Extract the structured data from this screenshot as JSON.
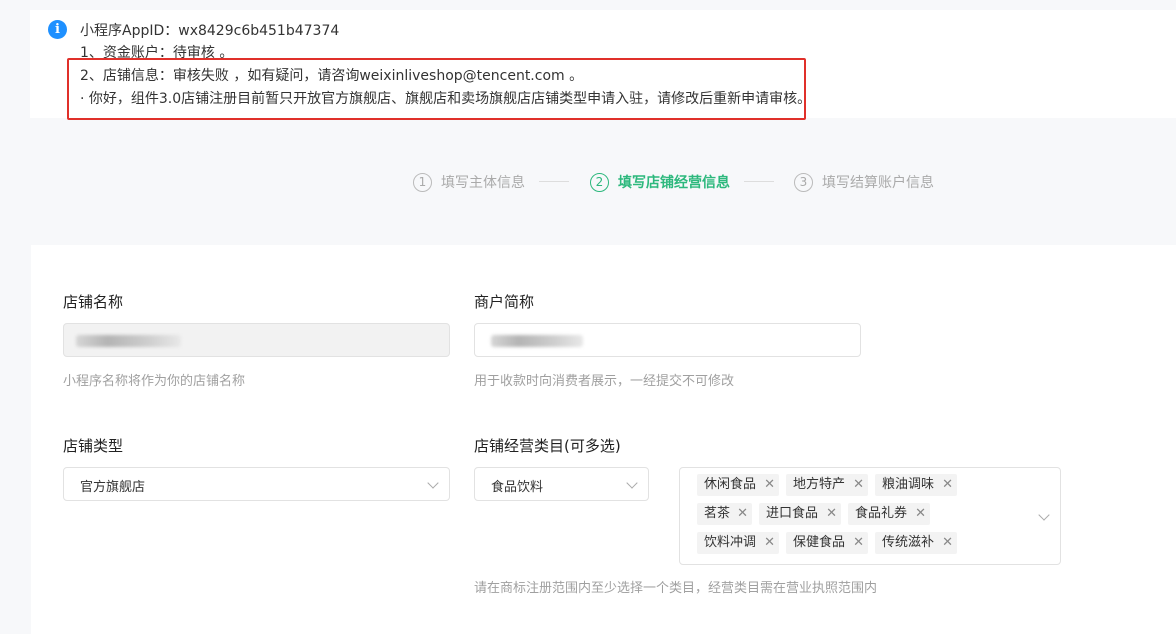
{
  "notice": {
    "appid_line": "小程序AppID：wx8429c6b451b47374",
    "line1": "1、资金账户：待审核 。",
    "line2": "2、店铺信息：审核失败 ，如有疑问，请咨询weixinliveshop@tencent.com 。",
    "line3": "· 你好，组件3.0店铺注册目前暂只开放官方旗舰店、旗舰店和卖场旗舰店店铺类型申请入驻，请修改后重新申请审核。"
  },
  "steps": [
    {
      "num": "1",
      "label": "填写主体信息"
    },
    {
      "num": "2",
      "label": "填写店铺经营信息"
    },
    {
      "num": "3",
      "label": "填写结算账户信息"
    }
  ],
  "form": {
    "shop_name_label": "店铺名称",
    "shop_name_hint": "小程序名称将作为你的店铺名称",
    "merchant_short_label": "商户简称",
    "merchant_short_hint": "用于收款时向消费者展示，一经提交不可修改",
    "shop_type_label": "店铺类型",
    "shop_type_value": "官方旗舰店",
    "category_label": "店铺经营类目(可多选)",
    "category_value": "食品饮料",
    "category_tags": [
      "休闲食品",
      "地方特产",
      "粮油调味",
      "茗茶",
      "进口食品",
      "食品礼券",
      "饮料冲调",
      "保健食品",
      "传统滋补"
    ],
    "category_hint": "请在商标注册范围内至少选择一个类目，经营类目需在营业执照范围内"
  },
  "icons": {
    "info": "info-icon",
    "chevron": "chevron-down-icon",
    "remove": "close-icon"
  },
  "colors": {
    "accent": "#2db87d",
    "info": "#1e90ff",
    "highlight_border": "#e0302a"
  }
}
